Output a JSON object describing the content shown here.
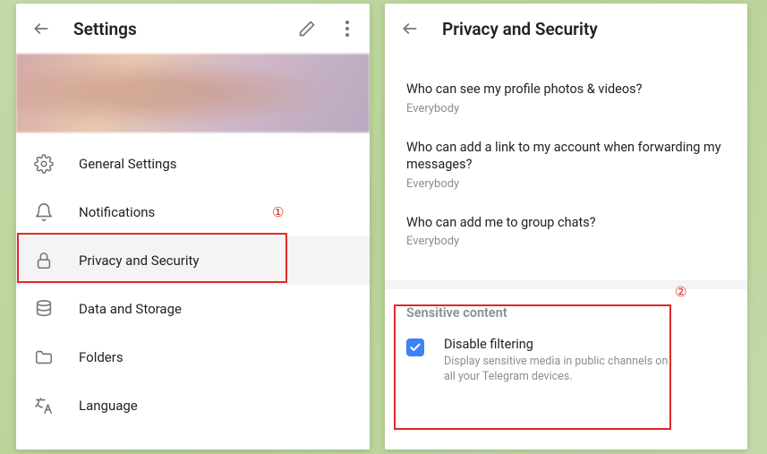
{
  "left": {
    "title": "Settings",
    "menu": [
      {
        "label": "General Settings"
      },
      {
        "label": "Notifications"
      },
      {
        "label": "Privacy and Security"
      },
      {
        "label": "Data and Storage"
      },
      {
        "label": "Folders"
      },
      {
        "label": "Language"
      }
    ]
  },
  "right": {
    "title": "Privacy and Security",
    "privacy": [
      {
        "q": "Who can see my profile photos & videos?",
        "v": "Everybody"
      },
      {
        "q": "Who can add a link to my account when forwarding my messages?",
        "v": "Everybody"
      },
      {
        "q": "Who can add me to group chats?",
        "v": "Everybody"
      }
    ],
    "sensitive": {
      "header": "Sensitive content",
      "label": "Disable filtering",
      "desc": "Display sensitive media in public channels on all your Telegram devices.",
      "checked": true
    }
  },
  "callouts": {
    "one": "①",
    "two": "②"
  }
}
